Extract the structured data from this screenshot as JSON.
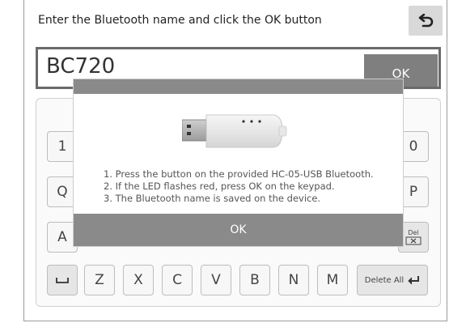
{
  "header": {
    "title": "Enter the Bluetooth name and click the OK button",
    "back_icon": "return-arrow-icon"
  },
  "name_field": {
    "value": "BC720",
    "ok_label": "OK"
  },
  "keyboard": {
    "row1_left": "1",
    "row1_right": "0",
    "row2_left": "Q",
    "row2_right": "P",
    "row3_left": "A",
    "del_label": "Del",
    "bottom_row": [
      "Z",
      "X",
      "C",
      "V",
      "B",
      "N",
      "M"
    ],
    "delete_all_label": "Delete All",
    "space_icon": "space-icon",
    "enter_icon": "enter-arrow-icon"
  },
  "modal": {
    "lines": [
      "1. Press the button on the provided HC-05-USB Bluetooth.",
      "2. If the LED flashes red, press OK on the keypad.",
      "3. The Bluetooth name is saved on the device."
    ],
    "ok_label": "OK",
    "image_icon": "usb-bluetooth-dongle-image"
  },
  "colors": {
    "button_gray": "#7f7f7f",
    "modal_gray": "#8a8a8a",
    "field_border": "#6a6a6a"
  }
}
